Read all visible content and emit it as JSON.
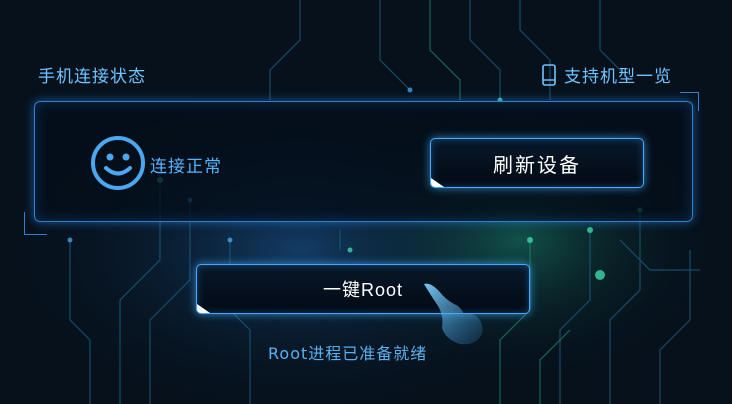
{
  "header": {
    "connection_title": "手机连接状态",
    "models_link": "支持机型一览"
  },
  "status": {
    "text": "连接正常",
    "icon": "smiley-face-icon"
  },
  "buttons": {
    "refresh": "刷新设备",
    "root": "一键Root"
  },
  "footer": {
    "status": "Root进程已准备就绪"
  },
  "icons": {
    "phone": "phone-icon",
    "pointer": "hand-pointer-icon"
  },
  "colors": {
    "accent": "#49a8ff",
    "text_blue": "#6fc3ff",
    "background": "#06111c"
  }
}
